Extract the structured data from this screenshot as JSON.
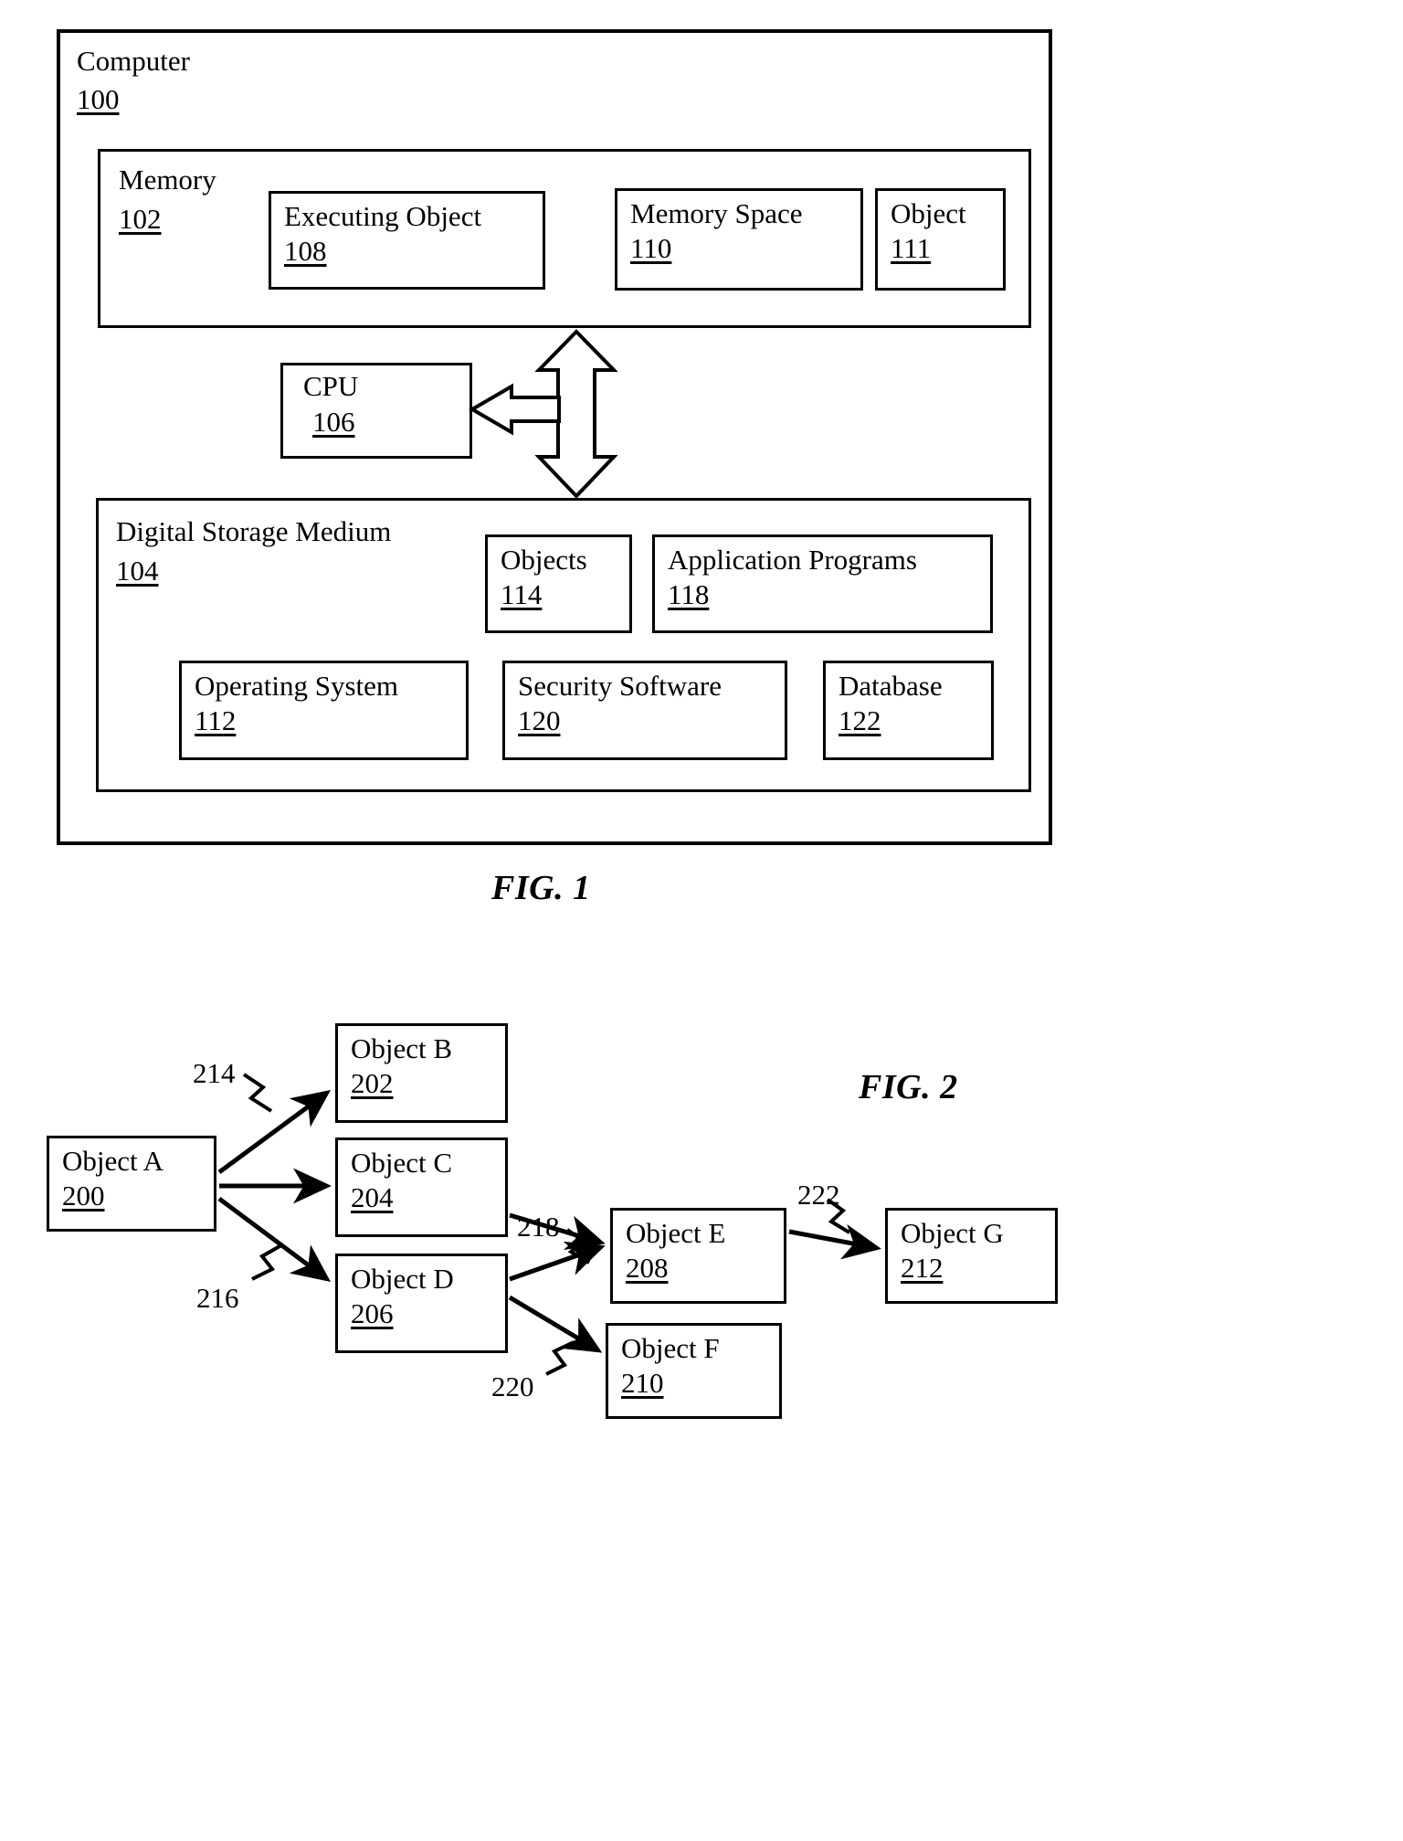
{
  "page": {
    "background": "#ffffff",
    "ink": "#000000"
  },
  "figures": [
    {
      "id": "fig1",
      "caption": "FIG. 1",
      "outer": {
        "label": "Computer",
        "number": "100"
      },
      "memory": {
        "label": "Memory",
        "number": "102"
      },
      "memory_items": [
        {
          "label": "Executing Object",
          "number": "108"
        },
        {
          "label": "Memory Space",
          "number": "110"
        },
        {
          "label": "Object",
          "number": "111"
        }
      ],
      "cpu": {
        "label": "CPU",
        "number": "106"
      },
      "storage": {
        "label": "Digital Storage Medium",
        "number": "104"
      },
      "storage_items_row1": [
        {
          "label": "Objects",
          "number": "114"
        },
        {
          "label": "Application Programs",
          "number": "118"
        }
      ],
      "storage_items_row2": [
        {
          "label": "Operating System",
          "number": "112"
        },
        {
          "label": "Security Software",
          "number": "120"
        },
        {
          "label": "Database",
          "number": "122"
        }
      ]
    },
    {
      "id": "fig2",
      "caption": "FIG. 2",
      "nodes": [
        {
          "label": "Object A",
          "number": "200"
        },
        {
          "label": "Object B",
          "number": "202"
        },
        {
          "label": "Object C",
          "number": "204"
        },
        {
          "label": "Object D",
          "number": "206"
        },
        {
          "label": "Object E",
          "number": "208"
        },
        {
          "label": "Object F",
          "number": "210"
        },
        {
          "label": "Object G",
          "number": "212"
        }
      ],
      "edge_labels": [
        {
          "number": "214"
        },
        {
          "number": "216"
        },
        {
          "number": "218"
        },
        {
          "number": "220"
        },
        {
          "number": "222"
        }
      ]
    }
  ]
}
